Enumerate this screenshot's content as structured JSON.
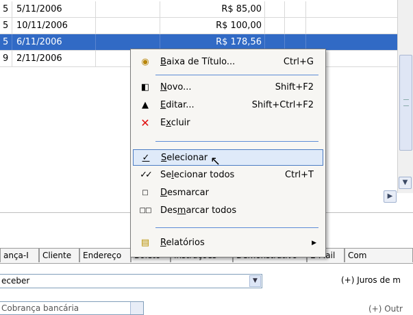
{
  "grid": {
    "rows": [
      {
        "num": "5",
        "date": "5/11/2006",
        "value": "R$ 85,00",
        "selected": false
      },
      {
        "num": "5",
        "date": "10/11/2006",
        "value": "R$ 100,00",
        "selected": false
      },
      {
        "num": "5",
        "date": "6/11/2006",
        "value": "R$ 178,56",
        "selected": true
      },
      {
        "num": "9",
        "date": "2/11/2006",
        "value": "",
        "selected": false
      }
    ]
  },
  "menu": {
    "baixa": {
      "pre": "",
      "u": "B",
      "post": "aixa de Título...",
      "shortcut": "Ctrl+G",
      "icon": "money-bag-icon"
    },
    "novo": {
      "pre": "",
      "u": "N",
      "post": "ovo...",
      "shortcut": "Shift+F2",
      "icon": "new-record-icon"
    },
    "editar": {
      "pre": "",
      "u": "E",
      "post": "ditar...",
      "shortcut": "Shift+Ctrl+F2",
      "icon": "edit-triangle-icon"
    },
    "excluir": {
      "pre": "E",
      "u": "x",
      "post": "cluir",
      "shortcut": "",
      "icon": "delete-x-icon"
    },
    "selecionar": {
      "pre": "",
      "u": "S",
      "post": "elecionar",
      "shortcut": "",
      "icon": "check-icon"
    },
    "selecionar_todos": {
      "pre": "Se",
      "u": "l",
      "post": "ecionar todos",
      "shortcut": "Ctrl+T",
      "icon": "double-check-icon"
    },
    "desmarcar": {
      "pre": "",
      "u": "D",
      "post": "esmarcar",
      "shortcut": "",
      "icon": "empty-box-icon"
    },
    "desmarcar_todos": {
      "pre": "Des",
      "u": "m",
      "post": "arcar todos",
      "shortcut": "",
      "icon": "double-box-icon"
    },
    "relatorios": {
      "pre": "",
      "u": "R",
      "post": "elatórios",
      "shortcut": "",
      "icon": "report-icon"
    }
  },
  "tabs": [
    "ança-I",
    "Cliente",
    "Endereço",
    "Boleto",
    "Instruções",
    "Demonstrativo",
    "E-Mail",
    "Com"
  ],
  "form": {
    "account_value": "eceber",
    "juros_label": "(+) Juros de m",
    "second_value": "Cobrança bancária",
    "extra_label": "(+) Outr"
  },
  "colors": {
    "selection": "#316ac5",
    "menu_highlight": "#dfeaf9",
    "separator": "#5b8bd6"
  }
}
